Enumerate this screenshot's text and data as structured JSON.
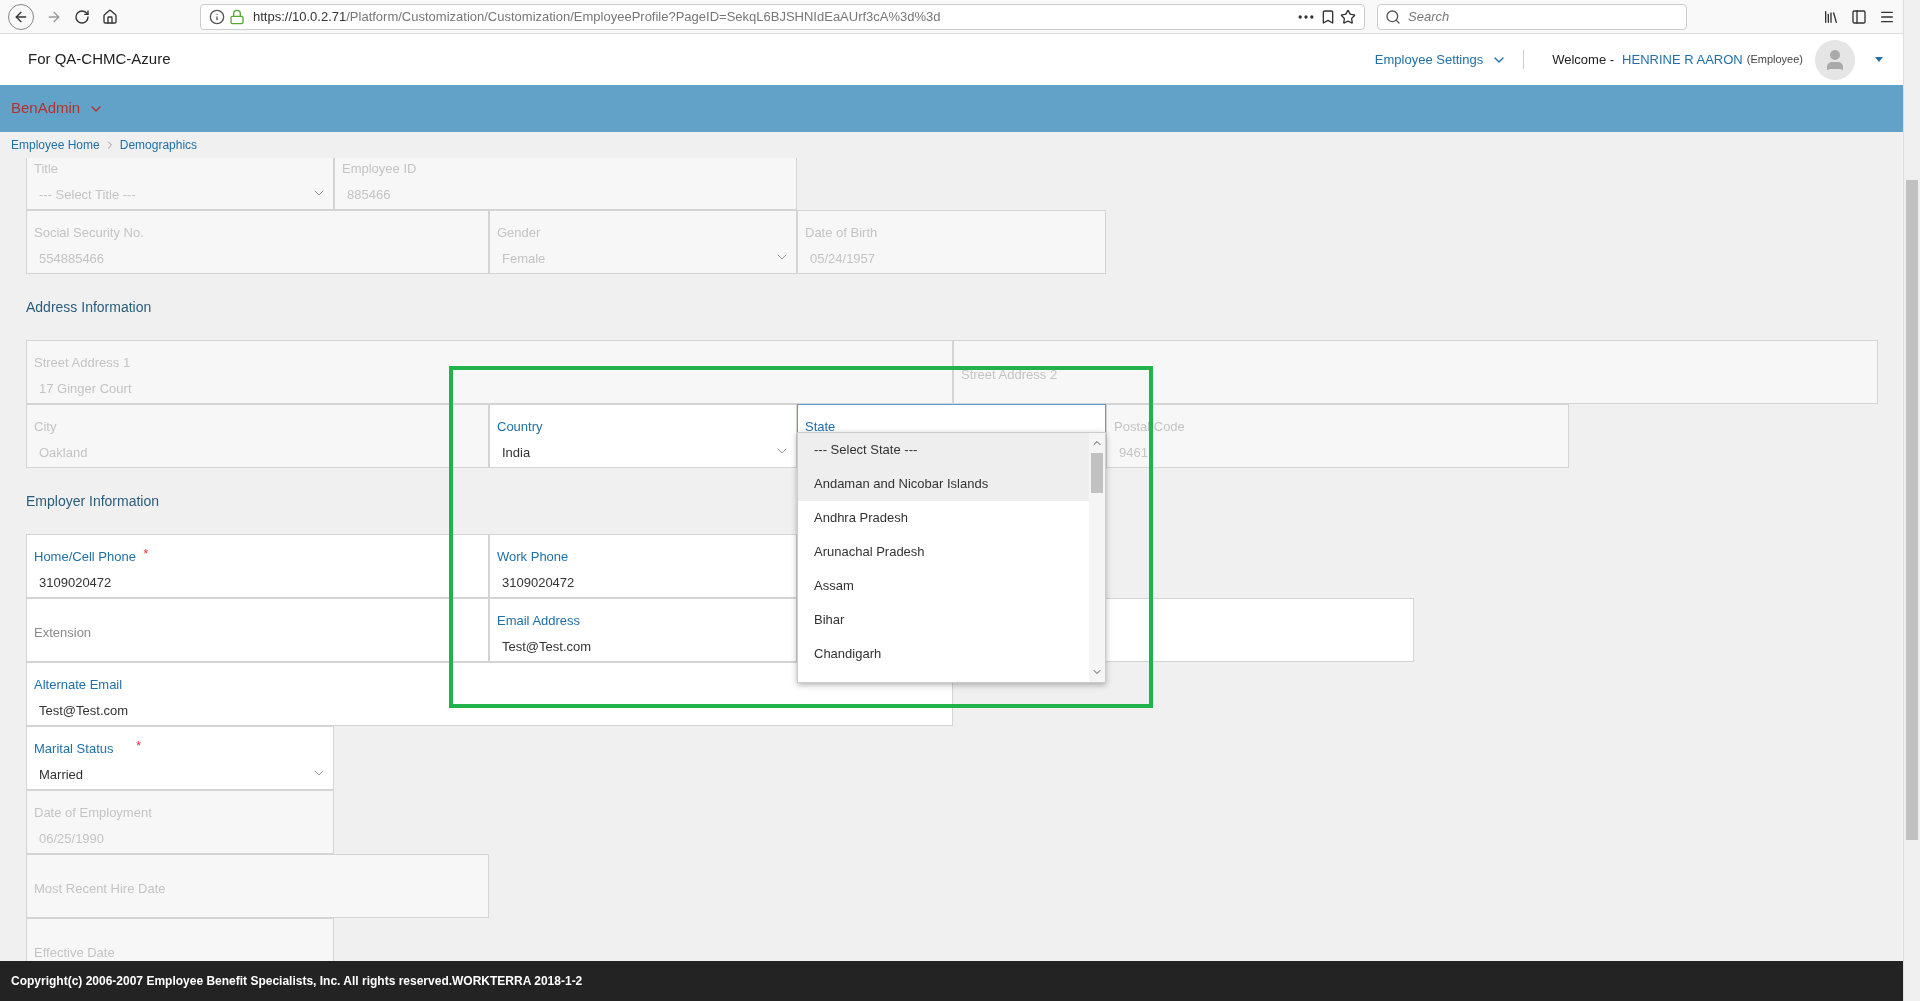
{
  "browser": {
    "url_host": "https://10.0.2.71",
    "url_path": "/Platform/Customization/Customization/EmployeeProfile?PageID=SekqL6BJSHNIdEaAUrf3cA%3d%3d",
    "search": {
      "placeholder": "Search"
    }
  },
  "header": {
    "org": "For QA-CHMC-Azure",
    "settings": "Employee Settings",
    "welcome": "Welcome -",
    "user": "HENRINE R AARON",
    "role": "(Employee)"
  },
  "menu": {
    "label": "BenAdmin"
  },
  "breadcrumb": [
    "Employee Home",
    "Demographics"
  ],
  "required_mark": "*",
  "form": [
    {
      "kind": "row",
      "fields": [
        {
          "kind": "select",
          "label": "Title",
          "value": "--- Select Title ---",
          "disabled": true
        },
        {
          "kind": "text",
          "label": "Employee ID",
          "value": "885466",
          "disabled": true
        }
      ]
    },
    {
      "kind": "row",
      "fields": [
        {
          "kind": "text",
          "label": "Social Security No.",
          "value": "554885466",
          "disabled": true
        },
        {
          "kind": "select",
          "label": "Gender",
          "value": "Female",
          "disabled": true
        },
        {
          "kind": "text",
          "label": "Date of Birth",
          "value": "05/24/1957",
          "disabled": true
        }
      ]
    },
    {
      "kind": "heading",
      "text": "Address Information"
    },
    {
      "kind": "row",
      "fields": [
        {
          "kind": "text",
          "label": "Street Address 1",
          "value": "17 Ginger Court",
          "disabled": true
        },
        {
          "kind": "text",
          "placeholder": "Street Address 2",
          "disabled": true
        }
      ]
    },
    {
      "kind": "row",
      "fields": [
        {
          "kind": "text",
          "label": "City",
          "value": "Oakland",
          "disabled": true
        },
        {
          "kind": "select",
          "label": "Country",
          "value": "India",
          "disabled": false
        },
        {
          "kind": "select",
          "label": "State",
          "disabled": false,
          "focused": true,
          "dropdown": [
            {
              "text": "--- Select State ---",
              "highlighted": true
            },
            {
              "text": "Andaman and Nicobar Islands",
              "highlighted": true
            },
            {
              "text": "Andhra Pradesh",
              "highlighted": false
            },
            {
              "text": "Arunachal Pradesh",
              "highlighted": false
            },
            {
              "text": "Assam",
              "highlighted": false
            },
            {
              "text": "Bihar",
              "highlighted": false
            },
            {
              "text": "Chandigarh",
              "highlighted": false
            }
          ]
        },
        {
          "kind": "text",
          "label": "Postal Code",
          "value": "9461",
          "disabled": true
        }
      ]
    },
    {
      "kind": "heading",
      "text": "Employer Information"
    },
    {
      "kind": "row",
      "fields": [
        {
          "kind": "text",
          "label": "Home/Cell Phone",
          "required": true,
          "value": "3109020472",
          "disabled": false
        },
        {
          "kind": "text",
          "label": "Work Phone",
          "value": "3109020472",
          "disabled": false
        }
      ]
    },
    {
      "kind": "row",
      "fields": [
        {
          "kind": "text",
          "placeholder": "Extension",
          "disabled": false
        },
        {
          "kind": "text",
          "label": "Email Address",
          "value": "Test@Test.com",
          "disabled": false
        },
        {
          "kind": "blank"
        }
      ]
    },
    {
      "kind": "row",
      "fields": [
        {
          "kind": "text",
          "label": "Alternate Email",
          "value": "Test@Test.com",
          "disabled": false
        }
      ]
    },
    {
      "kind": "row",
      "fields": [
        {
          "kind": "select",
          "label": "Marital Status",
          "required": true,
          "value": "Married",
          "disabled": false
        }
      ]
    },
    {
      "kind": "row",
      "fields": [
        {
          "kind": "text",
          "label": "Date of Employment",
          "value": "06/25/1990",
          "disabled": true
        }
      ]
    },
    {
      "kind": "row",
      "fields": [
        {
          "kind": "text",
          "placeholder": "Most Recent Hire Date",
          "disabled": true
        }
      ]
    },
    {
      "kind": "row",
      "fields": [
        {
          "kind": "text",
          "placeholder": "Effective Date",
          "disabled": true
        }
      ]
    }
  ],
  "footer": "Copyright(c) 2006-2007 Employee Benefit Specialists, Inc. All rights reserved.WORKTERRA 2018-1-2"
}
